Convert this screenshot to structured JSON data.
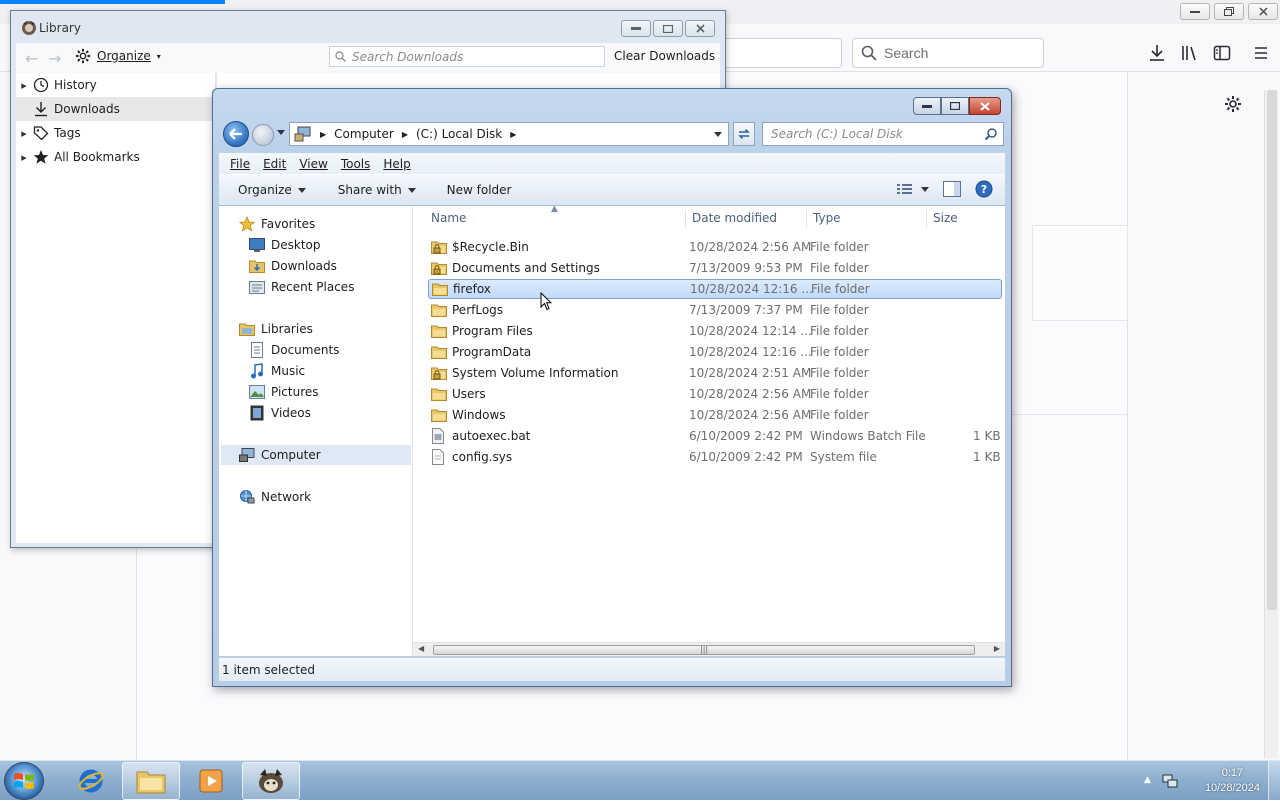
{
  "firefox": {
    "search_placeholder": "Search"
  },
  "library": {
    "title": "Library",
    "organize_label": "Organize",
    "search_placeholder": "Search Downloads",
    "clear_label": "Clear Downloads",
    "sidebar": [
      {
        "label": "History",
        "icon": "clock-icon",
        "expandable": true,
        "selected": false
      },
      {
        "label": "Downloads",
        "icon": "download-icon",
        "expandable": false,
        "selected": true
      },
      {
        "label": "Tags",
        "icon": "tag-icon",
        "expandable": true,
        "selected": false
      },
      {
        "label": "All Bookmarks",
        "icon": "star-icon",
        "expandable": true,
        "selected": false
      }
    ]
  },
  "explorer": {
    "breadcrumb": [
      "Computer",
      "(C:) Local Disk"
    ],
    "search_placeholder": "Search (C:) Local Disk",
    "menu": [
      "File",
      "Edit",
      "View",
      "Tools",
      "Help"
    ],
    "commands": {
      "organize": "Organize",
      "share": "Share with",
      "new_folder": "New folder"
    },
    "nav": {
      "favorites": "Favorites",
      "favorites_items": [
        "Desktop",
        "Downloads",
        "Recent Places"
      ],
      "libraries": "Libraries",
      "libraries_items": [
        "Documents",
        "Music",
        "Pictures",
        "Videos"
      ],
      "computer": "Computer",
      "network": "Network"
    },
    "columns": {
      "name": "Name",
      "date": "Date modified",
      "type": "Type",
      "size": "Size"
    },
    "files": [
      {
        "name": "$Recycle.Bin",
        "date": "10/28/2024 2:56 AM",
        "type": "File folder",
        "size": "",
        "icon": "locked-folder-icon"
      },
      {
        "name": "Documents and Settings",
        "date": "7/13/2009 9:53 PM",
        "type": "File folder",
        "size": "",
        "icon": "locked-folder-icon"
      },
      {
        "name": "firefox",
        "date": "10/28/2024 12:16 ...",
        "type": "File folder",
        "size": "",
        "icon": "folder-icon",
        "selected": true
      },
      {
        "name": "PerfLogs",
        "date": "7/13/2009 7:37 PM",
        "type": "File folder",
        "size": "",
        "icon": "folder-icon"
      },
      {
        "name": "Program Files",
        "date": "10/28/2024 12:14 ...",
        "type": "File folder",
        "size": "",
        "icon": "folder-icon"
      },
      {
        "name": "ProgramData",
        "date": "10/28/2024 12:16 ...",
        "type": "File folder",
        "size": "",
        "icon": "folder-icon"
      },
      {
        "name": "System Volume Information",
        "date": "10/28/2024 2:51 AM",
        "type": "File folder",
        "size": "",
        "icon": "locked-folder-icon"
      },
      {
        "name": "Users",
        "date": "10/28/2024 2:56 AM",
        "type": "File folder",
        "size": "",
        "icon": "folder-icon"
      },
      {
        "name": "Windows",
        "date": "10/28/2024 2:56 AM",
        "type": "File folder",
        "size": "",
        "icon": "folder-icon"
      },
      {
        "name": "autoexec.bat",
        "date": "6/10/2009 2:42 PM",
        "type": "Windows Batch File",
        "size": "1 KB",
        "icon": "batch-file-icon"
      },
      {
        "name": "config.sys",
        "date": "6/10/2009 2:42 PM",
        "type": "System file",
        "size": "1 KB",
        "icon": "system-file-icon"
      }
    ],
    "status": "1 item selected"
  },
  "taskbar": {
    "time": "0:17",
    "date": "10/28/2024"
  },
  "colors": {
    "selection": "#cce4fc",
    "accent": "#0a84ff",
    "taskbar": "#8fb0d0"
  }
}
